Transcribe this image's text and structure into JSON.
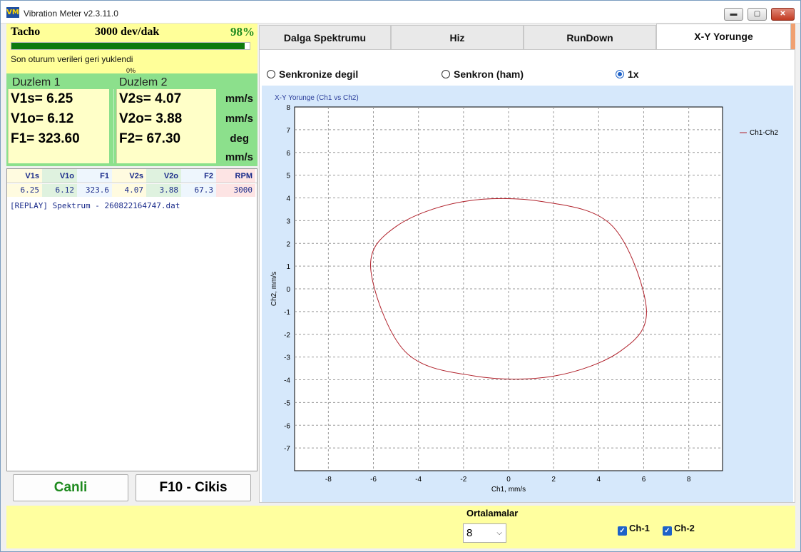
{
  "window": {
    "title": "Vibration Meter v2.3.11.0",
    "icon_text": "VM",
    "buttons": [
      "▬",
      "▢",
      "✕"
    ]
  },
  "tacho": {
    "label": "Tacho",
    "rpm_text": "3000 dev/dak",
    "percent_text": "98%",
    "progress": 0.98,
    "restore_msg": "Son oturum verileri geri yuklendi",
    "sub_percent": "0%"
  },
  "plane1": {
    "title": "Duzlem 1",
    "v1s": "V1s= 6.25",
    "v1o": "V1o= 6.12",
    "f1": "F1= 323.60"
  },
  "plane2": {
    "title": "Duzlem 2",
    "v2s": "V2s= 4.07",
    "v2o": "V2o= 3.88",
    "f2": "F2= 67.30"
  },
  "units": [
    "mm/s",
    "mm/s",
    "deg",
    "mm/s"
  ],
  "grid": {
    "headers": [
      "V1s",
      "V1o",
      "F1",
      "V2s",
      "V2o",
      "F2",
      "RPM"
    ],
    "row": [
      "6.25",
      "6.12",
      "323.6",
      "4.07",
      "3.88",
      "67.3",
      "3000"
    ]
  },
  "log": {
    "line": "[REPLAY] Spektrum - 260822164747.dat"
  },
  "buttons": {
    "live": "Canli",
    "exit": "F10 - Cikis"
  },
  "tabs": [
    "Dalga Spektrumu",
    "Hiz",
    "RunDown",
    "X-Y Yorunge"
  ],
  "active_tab": "X-Y Yorunge",
  "radios": {
    "async": "Senkronize degil",
    "sync_raw": "Senkron (ham)",
    "one_x": "1x",
    "selected": "1x"
  },
  "bottom": {
    "averages_label": "Ortalamalar",
    "averages_value": "8",
    "ch1": "Ch-1",
    "ch2": "Ch-2",
    "ch1_checked": true,
    "ch2_checked": true
  },
  "chart_data": {
    "type": "line",
    "title": "X-Y Yorunge (Ch1 vs Ch2)",
    "xlabel": "Ch1, mm/s",
    "ylabel": "Ch2, mm/s",
    "xlim": [
      -9.5,
      9.5
    ],
    "ylim": [
      -8,
      8
    ],
    "xticks": [
      -8,
      -6,
      -4,
      -2,
      0,
      2,
      4,
      6,
      8
    ],
    "yticks": [
      8,
      7,
      6,
      5,
      4,
      3,
      2,
      1,
      0,
      -1,
      -2,
      -3,
      -4,
      -5,
      -6,
      -7
    ],
    "grid": true,
    "legend": "top-right",
    "series": [
      {
        "name": "Ch1-Ch2",
        "color": "#b0202a",
        "shape": "ellipse",
        "x": [
          6.12,
          4.97,
          2.0,
          -1.53,
          -4.6,
          -6.12,
          -5.0,
          -2.0,
          1.55,
          4.62,
          6.12
        ],
        "y": [
          -0.9,
          -2.74,
          -3.84,
          -3.83,
          -2.75,
          0.9,
          2.74,
          3.84,
          3.83,
          2.75,
          -0.9
        ]
      }
    ]
  }
}
